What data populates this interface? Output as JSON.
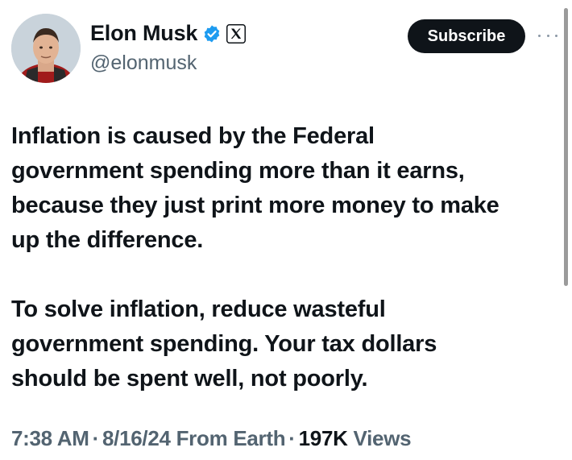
{
  "author": {
    "display_name": "Elon Musk",
    "handle": "@elonmusk",
    "avatar_icon": "profile-photo",
    "verified_icon": "verified-badge-icon",
    "affiliation_icon": "x-logo-icon"
  },
  "actions": {
    "subscribe_label": "Subscribe",
    "more_icon": "more-options-icon"
  },
  "tweet": {
    "paragraphs": [
      "Inflation is caused by the Federal\ngovernment spending more than it earns,\nbecause they just print more money to make\nup the difference.",
      "To solve inflation, reduce wasteful\ngovernment spending. Your tax dollars\nshould be spent well, not poorly."
    ],
    "time": "7:38 AM",
    "date": "8/16/24",
    "source": "From Earth",
    "separator": "·",
    "views_count": "197K",
    "views_label": "Views"
  },
  "colors": {
    "text_primary": "#0f1419",
    "text_secondary": "#536471",
    "verified_blue": "#1d9bf0",
    "button_bg": "#0f1419"
  }
}
